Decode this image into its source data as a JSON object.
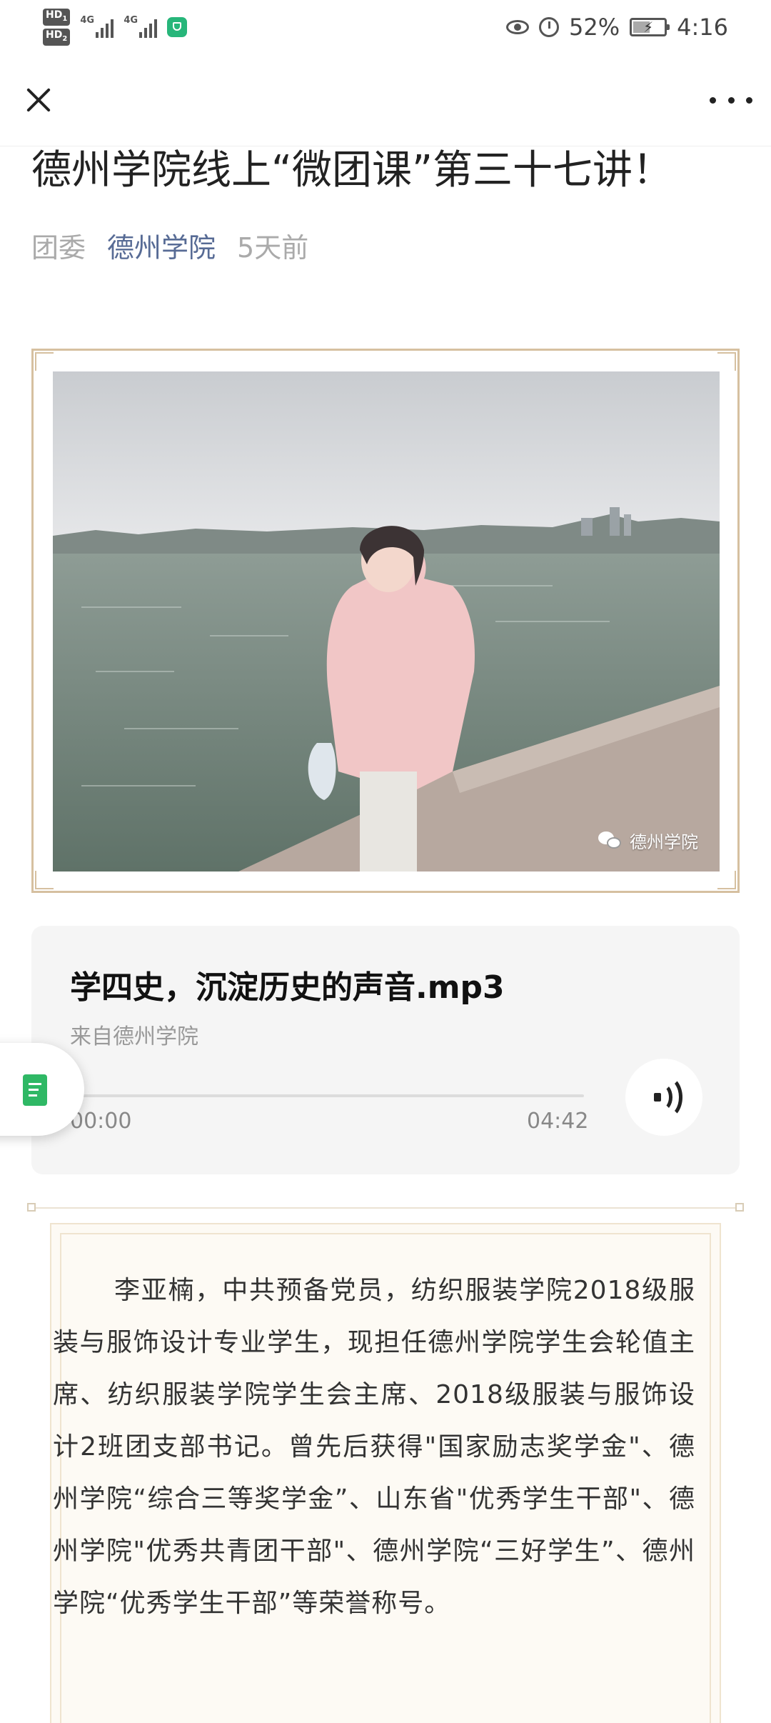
{
  "status_bar": {
    "hd1": "HD",
    "hd1_sub": "1",
    "hd2": "HD",
    "hd2_sub": "2",
    "net1": "4G",
    "net2": "4G",
    "battery_percent": "52%",
    "battery_level": 0.52,
    "time": "4:16"
  },
  "header": {
    "close_icon": "close-icon",
    "more_icon": "more-dots-icon"
  },
  "article": {
    "title": "德州学院线上“微团课”第三十七讲！",
    "author": "团委",
    "account": "德州学院",
    "time_ago": "5天前"
  },
  "photo": {
    "watermark": "德州学院"
  },
  "audio": {
    "title": "学四史，沉淀历史的声音.mp3",
    "source": "来自德州学院",
    "current_time": "00:00",
    "duration": "04:42",
    "progress": 0
  },
  "body": {
    "paragraph": "李亚楠，中共预备党员，纺织服装学院2018级服装与服饰设计专业学生，现担任德州学院学生会轮值主席、纺织服装学院学生会主席、2018级服装与服饰设计2班团支部书记。曾先后获得\"国家励志奖学金\"、德州学院“综合三等奖学金”、山东省\"优秀学生干部\"、德州学院\"优秀共青团干部\"、德州学院“三好学生”、德州学院“优秀学生干部”等荣誉称号。"
  }
}
